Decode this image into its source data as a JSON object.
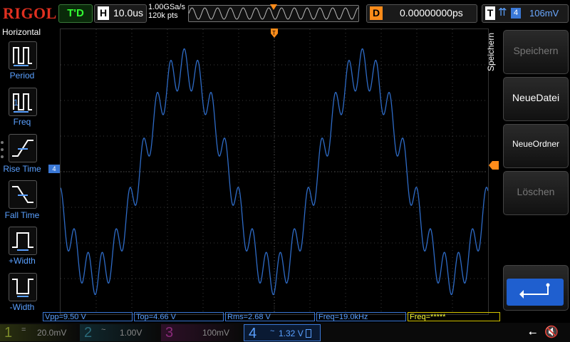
{
  "topbar": {
    "brand": "RIGOL",
    "status": "T'D",
    "timebase_label": "H",
    "timebase_value": "10.0us",
    "sample_rate": "1.00GSa/s",
    "memory_depth": "120k pts",
    "delay_label": "D",
    "delay_value": "0.00000000ps",
    "trigger_label": "T",
    "trigger_source": "4",
    "trigger_level": "106mV"
  },
  "left_menu": {
    "title": "Horizontal",
    "items": [
      {
        "label": "Period",
        "icon": "period-icon"
      },
      {
        "label": "Freq",
        "icon": "freq-icon"
      },
      {
        "label": "Rise Time",
        "icon": "rise-time-icon"
      },
      {
        "label": "Fall Time",
        "icon": "fall-time-icon"
      },
      {
        "label": "+Width",
        "icon": "positive-width-icon"
      },
      {
        "label": "-Width",
        "icon": "negative-width-icon"
      }
    ]
  },
  "right_menu": {
    "title": "Speichern",
    "keys": [
      {
        "label": "Speichern",
        "enabled": false
      },
      {
        "label": "NeueDatei",
        "enabled": true
      },
      {
        "label": "NeueOrdner",
        "enabled": true
      },
      {
        "label": "Löschen",
        "enabled": false
      }
    ],
    "return_icon": "return-arrow-icon"
  },
  "markers": {
    "ch4_ground": "4"
  },
  "measurements": [
    {
      "text": "Vpp=9.50 V",
      "color": "blue"
    },
    {
      "text": "Top=4.66 V",
      "color": "blue"
    },
    {
      "text": "Rms=2.68 V",
      "color": "blue"
    },
    {
      "text": "Freq=19.0kHz",
      "color": "blue"
    },
    {
      "text": "Freq=*****",
      "color": "yellow"
    }
  ],
  "channels": [
    {
      "num": "1",
      "coupling": "=",
      "scale": "20.0mV",
      "color": "#4a5a1a"
    },
    {
      "num": "2",
      "coupling": "~",
      "scale": "1.00V",
      "color": "#1a4a5a"
    },
    {
      "num": "3",
      "coupling": "",
      "scale": "100mV",
      "color": "#5a1a4a"
    },
    {
      "num": "4",
      "coupling": "~",
      "scale": "1.32 V",
      "color": "#3a78d6",
      "active": true
    }
  ],
  "colors": {
    "trace": "#2e6bc6",
    "grid": "#3a3a3a",
    "trigger": "#ff8c1a",
    "accent": "#3a78d6"
  },
  "waveform": {
    "carrier_cycles_visible": 2.4,
    "ripple_cycles_per_carrier": 13,
    "carrier_amplitude_divs": 2.9,
    "ripple_amplitude_divs": 0.55,
    "carrier_phase_start_deg": 200
  }
}
